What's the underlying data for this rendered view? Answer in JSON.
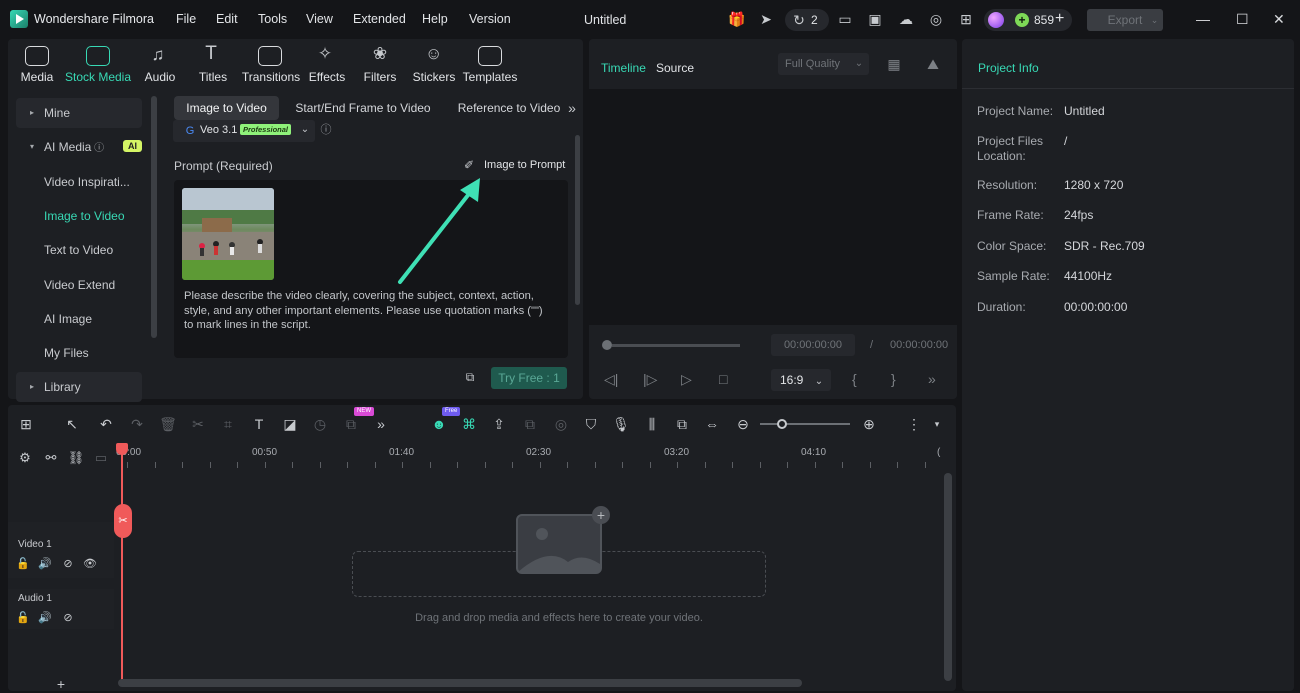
{
  "app": {
    "name": "Wondershare Filmora",
    "title": "Untitled",
    "menu": [
      "File",
      "Edit",
      "Tools",
      "View",
      "Extended",
      "Help",
      "Version"
    ],
    "collab_count": "2",
    "credits": "859",
    "export_label": "Export"
  },
  "library": {
    "tabs": [
      "Media",
      "Stock Media",
      "Audio",
      "Titles",
      "Transitions",
      "Effects",
      "Filters",
      "Stickers",
      "Templates"
    ],
    "sidebar": [
      "Mine",
      "AI Media",
      "Video Inspirati...",
      "Image to Video",
      "Text to Video",
      "Video Extend",
      "AI Image",
      "My Files",
      "Library"
    ],
    "ai_badge": "AI",
    "subtabs": [
      "Image to Video",
      "Start/End Frame to Video",
      "Reference to Video"
    ],
    "model": "Veo 3.1",
    "model_badge": "Professional",
    "prompt_label": "Prompt (Required)",
    "image_to_prompt": "Image to Prompt",
    "prompt_hint": "Please describe the video clearly, covering the subject, context, action, style, and any other important elements. Please use quotation marks (\"\") to mark lines in the script.",
    "try_free": "Try Free : 1"
  },
  "player": {
    "tabs": [
      "Timeline",
      "Source"
    ],
    "quality": "Full Quality",
    "current": "00:00:00:00",
    "sep": "/",
    "total": "00:00:00:00",
    "ratio": "16:9"
  },
  "project_info": {
    "title": "Project Info",
    "rows": [
      {
        "label": "Project Name:",
        "value": "Untitled"
      },
      {
        "label": "Project Files Location:",
        "value": "/"
      },
      {
        "label": "Resolution:",
        "value": "1280 x 720"
      },
      {
        "label": "Frame Rate:",
        "value": "24fps"
      },
      {
        "label": "Color Space:",
        "value": "SDR - Rec.709"
      },
      {
        "label": "Sample Rate:",
        "value": "44100Hz"
      },
      {
        "label": "Duration:",
        "value": "00:00:00:00"
      }
    ]
  },
  "timeline": {
    "ruler": [
      "00:00",
      "00:50",
      "01:40",
      "02:30",
      "03:20",
      "04:10"
    ],
    "tracks": [
      "Video 1",
      "Audio 1"
    ],
    "drop_hint": "Drag and drop media and effects here to create your video.",
    "badge_new": "NEW",
    "badge_free": "Free"
  },
  "colors": {
    "accent": "#38d9b5",
    "arrow": "#3fe0b5",
    "playhead": "#f05a5a"
  }
}
